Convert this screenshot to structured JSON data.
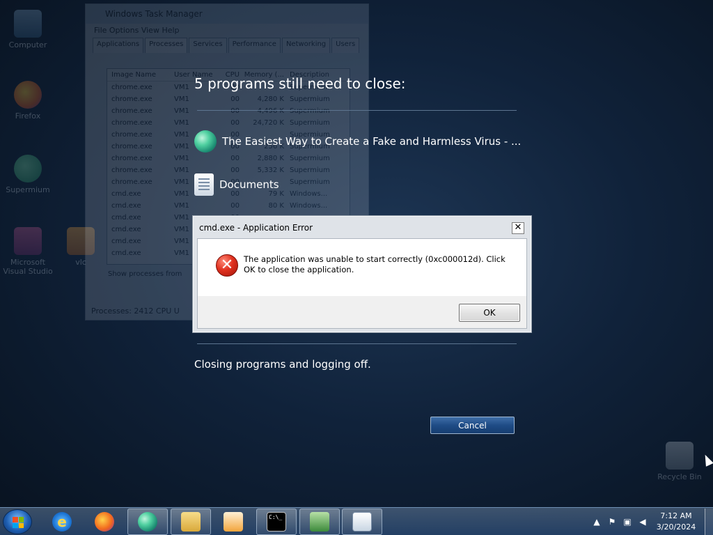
{
  "desktop": {
    "icons": [
      {
        "label": "Computer",
        "icon": "computer-icon"
      },
      {
        "label": "Firefox",
        "icon": "firefox-icon"
      },
      {
        "label": "Supermium",
        "icon": "supermium-icon"
      },
      {
        "label": "Microsoft Visual Studio",
        "icon": "visual-studio-icon"
      },
      {
        "label": "vlc",
        "icon": "vlc-icon"
      },
      {
        "label": "Recycle Bin",
        "icon": "recycle-bin-icon"
      }
    ]
  },
  "task_manager": {
    "title": "Windows Task Manager",
    "menu": "File   Options   View   Help",
    "tabs": [
      "Applications",
      "Processes",
      "Services",
      "Performance",
      "Networking",
      "Users"
    ],
    "active_tab": "Processes",
    "columns": [
      "Image Name",
      "User Name",
      "CPU",
      "Memory (...",
      "Description"
    ],
    "rows": [
      [
        "chrome.exe",
        "VM1",
        "00",
        "",
        "Supermium"
      ],
      [
        "chrome.exe",
        "VM1",
        "00",
        "4,280 K",
        "Supermium"
      ],
      [
        "chrome.exe",
        "VM1",
        "00",
        "4,496 K",
        "Supermium"
      ],
      [
        "chrome.exe",
        "VM1",
        "00",
        "24,720 K",
        "Supermium"
      ],
      [
        "chrome.exe",
        "VM1",
        "00",
        "",
        "Supermium"
      ],
      [
        "chrome.exe",
        "VM1",
        "00",
        "256 K",
        "Supermium"
      ],
      [
        "chrome.exe",
        "VM1",
        "00",
        "2,880 K",
        "Supermium"
      ],
      [
        "chrome.exe",
        "VM1",
        "00",
        "5,332 K",
        "Supermium"
      ],
      [
        "chrome.exe",
        "VM1",
        "00",
        "",
        "Supermium"
      ],
      [
        "cmd.exe",
        "VM1",
        "00",
        "79 K",
        "Windows..."
      ],
      [
        "cmd.exe",
        "VM1",
        "00",
        "80 K",
        "Windows..."
      ],
      [
        "cmd.exe",
        "VM1",
        "00",
        "",
        ""
      ],
      [
        "cmd.exe",
        "VM1",
        "00",
        "",
        ""
      ],
      [
        "cmd.exe",
        "VM1",
        "00",
        "",
        ""
      ],
      [
        "cmd.exe",
        "VM1",
        "00",
        "",
        ""
      ]
    ],
    "show_processes": "Show processes from",
    "footer": "Processes: 2412     CPU U"
  },
  "logoff": {
    "title": "5 programs still need to close:",
    "programs": [
      {
        "name": "The Easiest Way to Create a Fake and Harmless Virus - ...",
        "icon": "supermium-icon"
      },
      {
        "name": "Documents",
        "icon": "documents-icon"
      }
    ],
    "status": "Closing programs and logging off.",
    "cancel_label": "Cancel"
  },
  "dialog": {
    "title": "cmd.exe - Application Error",
    "close_glyph": "✕",
    "message": "The application was unable to start correctly (0xc000012d). Click OK to close the application.",
    "icon": "error-icon",
    "ok_label": "OK"
  },
  "taskbar": {
    "pinned": [
      {
        "name": "internet-explorer",
        "icon": "internet-explorer-icon",
        "open": false
      },
      {
        "name": "firefox",
        "icon": "firefox-icon",
        "open": false
      },
      {
        "name": "supermium",
        "icon": "supermium-icon",
        "open": true
      },
      {
        "name": "windows-explorer",
        "icon": "folder-icon",
        "open": true
      },
      {
        "name": "vlc",
        "icon": "vlc-icon",
        "open": false
      },
      {
        "name": "cmd",
        "icon": "cmd-icon",
        "open": true
      },
      {
        "name": "task-manager",
        "icon": "task-manager-icon",
        "open": true
      },
      {
        "name": "document",
        "icon": "document-icon",
        "open": true
      }
    ],
    "cmd_glyph_text": "C:\\_",
    "clock_time": "7:12 AM",
    "clock_date": "3/20/2024"
  },
  "colors": {
    "desktop_bg": "#10223a",
    "cancel_button": "#1f4c86",
    "error_red": "#e0311f",
    "dialog_frame": "#dfe3e8"
  }
}
